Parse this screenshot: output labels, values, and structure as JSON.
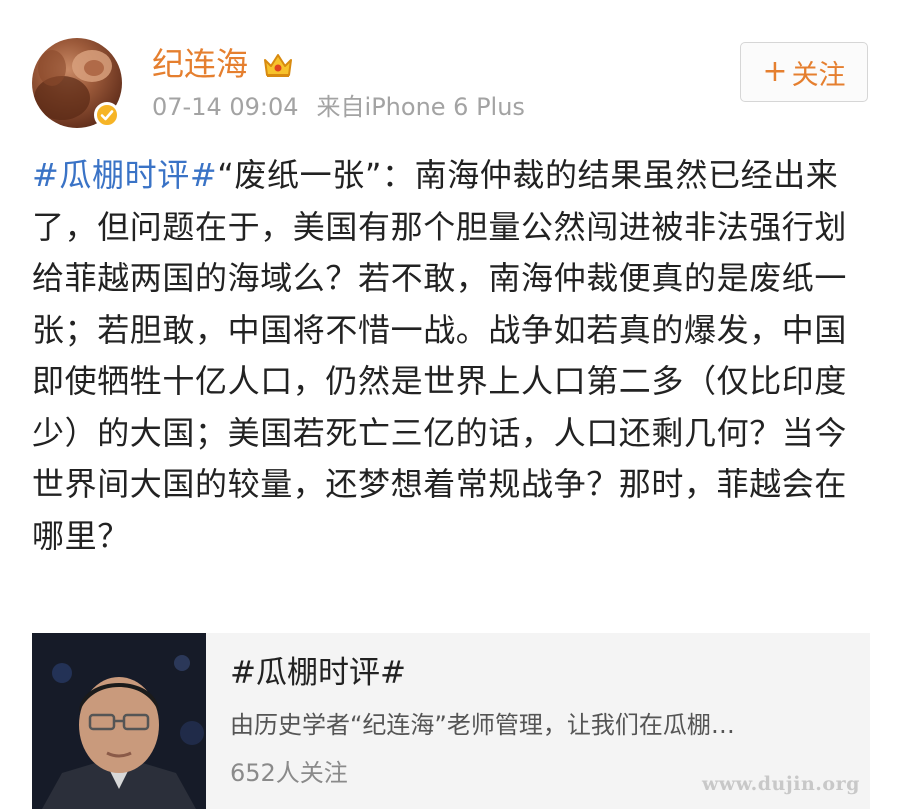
{
  "post": {
    "author": {
      "name": "纪连海",
      "verified": true,
      "vip_badge_icon": "crown-icon",
      "verified_icon": "verified-check-icon"
    },
    "time": "07-14 09:04",
    "source": "来自iPhone 6 Plus",
    "follow_button": {
      "plus": "+",
      "label": "关注"
    },
    "hashtag": "#瓜棚时评#",
    "text": "“废纸一张”：南海仲裁的结果虽然已经出来了，但问题在于，美国有那个胆量公然闯进被非法强行划给菲越两国的海域么？若不敢，南海仲裁便真的是废纸一张；若胆敢，中国将不惜一战。战争如若真的爆发，中国即使牺牲十亿人口，仍然是世界上人口第二多（仅比印度少）的大国；美国若死亡三亿的话，人口还剩几何？当今世界间大国的较量，还梦想着常规战争？那时，菲越会在哪里？"
  },
  "topic_card": {
    "title": "#瓜棚时评#",
    "description": "由历史学者“纪连海”老师管理，让我们在瓜棚…",
    "followers": "652人关注"
  },
  "watermark": "www.dujin.org",
  "colors": {
    "username": "#e57f2f",
    "hashtag": "#3a73c6",
    "meta": "#a3a3a3",
    "verified_badge": "#f6b426",
    "card_background": "#f4f4f4"
  }
}
